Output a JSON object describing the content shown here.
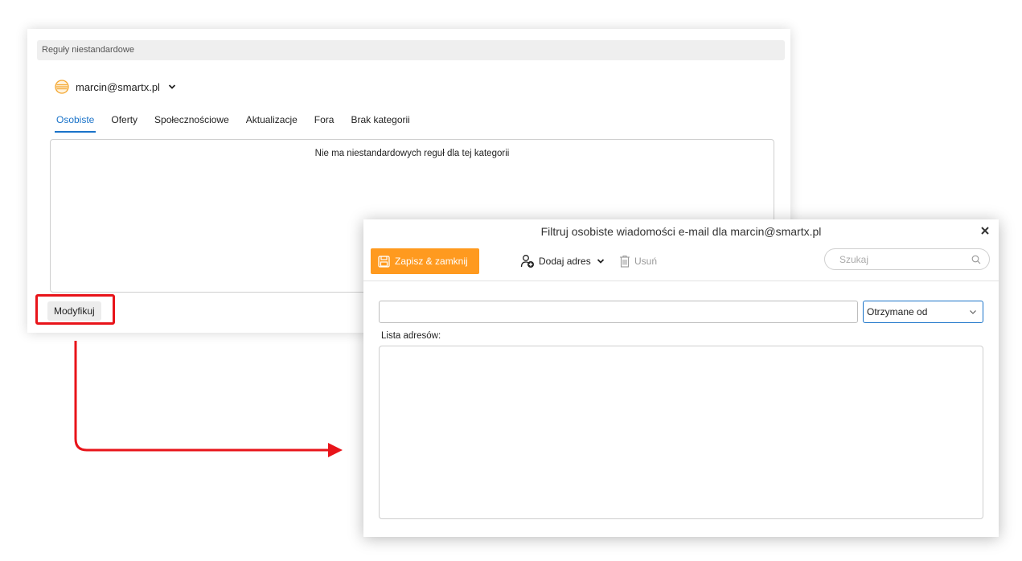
{
  "rules_panel": {
    "header": "Reguły niestandardowe",
    "account": "marcin@smartx.pl",
    "tabs": [
      {
        "label": "Osobiste",
        "active": true
      },
      {
        "label": "Oferty",
        "active": false
      },
      {
        "label": "Społecznościowe",
        "active": false
      },
      {
        "label": "Aktualizacje",
        "active": false
      },
      {
        "label": "Fora",
        "active": false
      },
      {
        "label": "Brak kategorii",
        "active": false
      }
    ],
    "empty_message": "Nie ma niestandardowych reguł dla tej kategorii",
    "modify_button": "Modyfikuj"
  },
  "dialog": {
    "title": "Filtruj osobiste wiadomości e-mail dla marcin@smartx.pl",
    "save_button": "Zapisz & zamknij",
    "add_address_button": "Dodaj adres",
    "delete_button": "Usuń",
    "search_placeholder": "Szukaj",
    "address_value": "",
    "filter_select": "Otrzymane od",
    "list_label": "Lista adresów:"
  },
  "colors": {
    "accent_blue": "#1a73c9",
    "save_orange": "#ff9a1f",
    "annotation_red": "#e8141a"
  },
  "icons": {
    "account": "mail-account-icon",
    "save": "save-icon",
    "add_address": "add-user-icon",
    "delete": "trash-icon",
    "search": "search-icon",
    "close": "close-icon"
  }
}
